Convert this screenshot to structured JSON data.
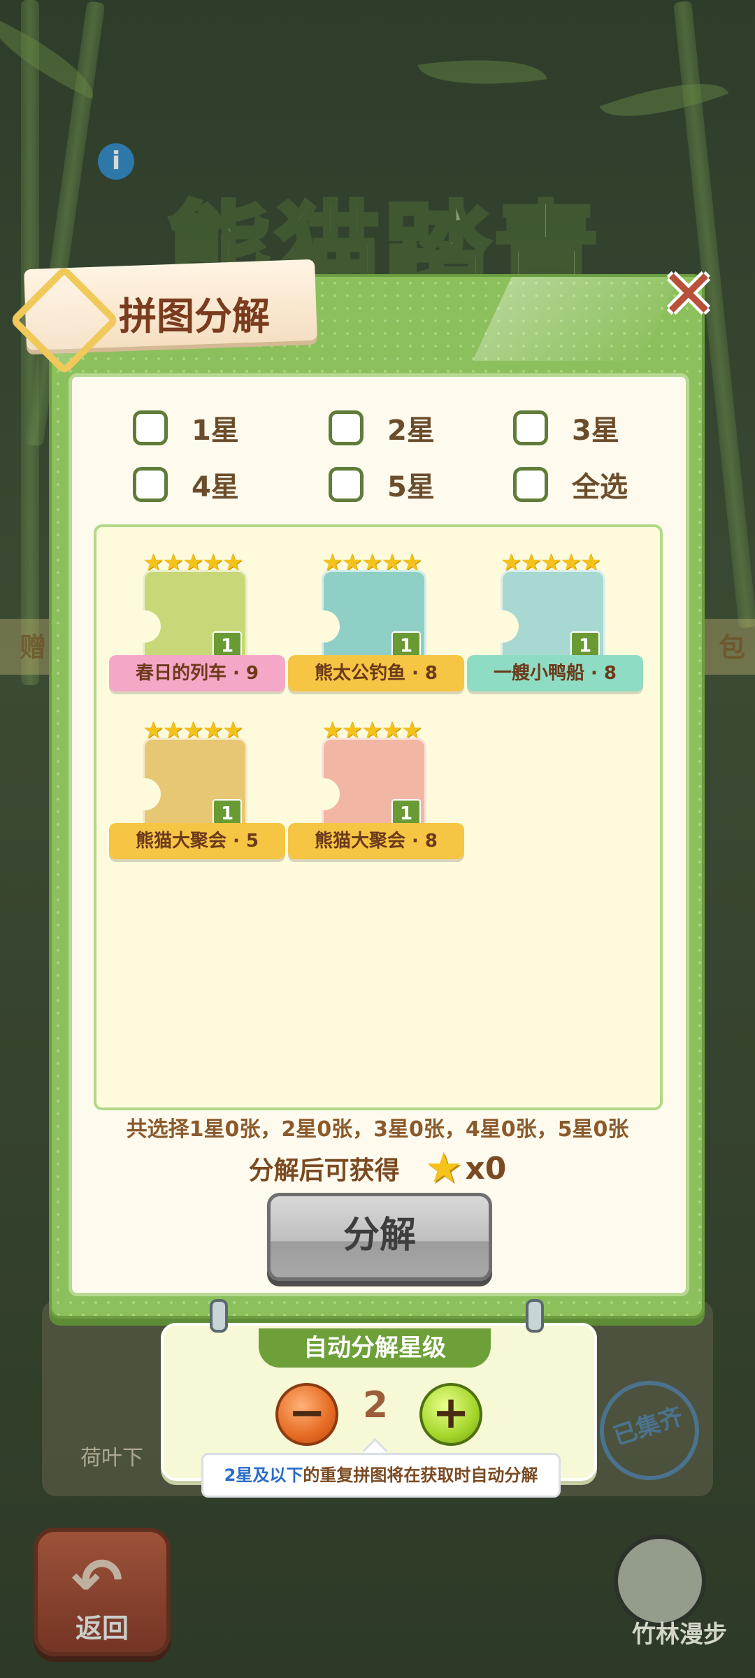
{
  "background": {
    "event_title": "熊猫踏青季",
    "left_banner_text": "赠",
    "right_banner_text": "包",
    "card_label": "荷叶下",
    "stamp_text": "已集齐",
    "mascot_label": "竹林漫步"
  },
  "dialog": {
    "title": "拼图分解",
    "filters": [
      {
        "label": "1星",
        "checked": false
      },
      {
        "label": "2星",
        "checked": false
      },
      {
        "label": "3星",
        "checked": false
      },
      {
        "label": "4星",
        "checked": false
      },
      {
        "label": "5星",
        "checked": false
      },
      {
        "label": "全选",
        "checked": false
      }
    ],
    "cards": [
      {
        "name": "春日的列车 · 9",
        "stars": "★★★★★",
        "count": "1",
        "ribbon_color": "#f5a7c8",
        "art_color": "#c8d878"
      },
      {
        "name": "熊太公钓鱼 · 8",
        "stars": "★★★★★",
        "count": "1",
        "ribbon_color": "#f6c544",
        "art_color": "#8fcfc6"
      },
      {
        "name": "一艘小鸭船 · 8",
        "stars": "★★★★★",
        "count": "1",
        "ribbon_color": "#8fdcc4",
        "art_color": "#a8d8d2"
      },
      {
        "name": "熊猫大聚会 · 5",
        "stars": "★★★★★",
        "count": "1",
        "ribbon_color": "#f6c544",
        "art_color": "#e8c774"
      },
      {
        "name": "熊猫大聚会 · 8",
        "stars": "★★★★★",
        "count": "1",
        "ribbon_color": "#f6c544",
        "art_color": "#f2b7a4"
      }
    ],
    "summary": "共选择1星0张，2星0张，3星0张，4星0张，5星0张",
    "reward_label": "分解后可获得",
    "reward_count": "x0",
    "decompose_button": "分解"
  },
  "auto": {
    "title": "自动分解星级",
    "level": "2",
    "minus_label": "−",
    "plus_label": "+",
    "tip_highlight": "2星及以下",
    "tip_rest": "的重复拼图将在获取时自动分解"
  },
  "footer": {
    "back_label": "返回",
    "back_arrow": "↶"
  }
}
